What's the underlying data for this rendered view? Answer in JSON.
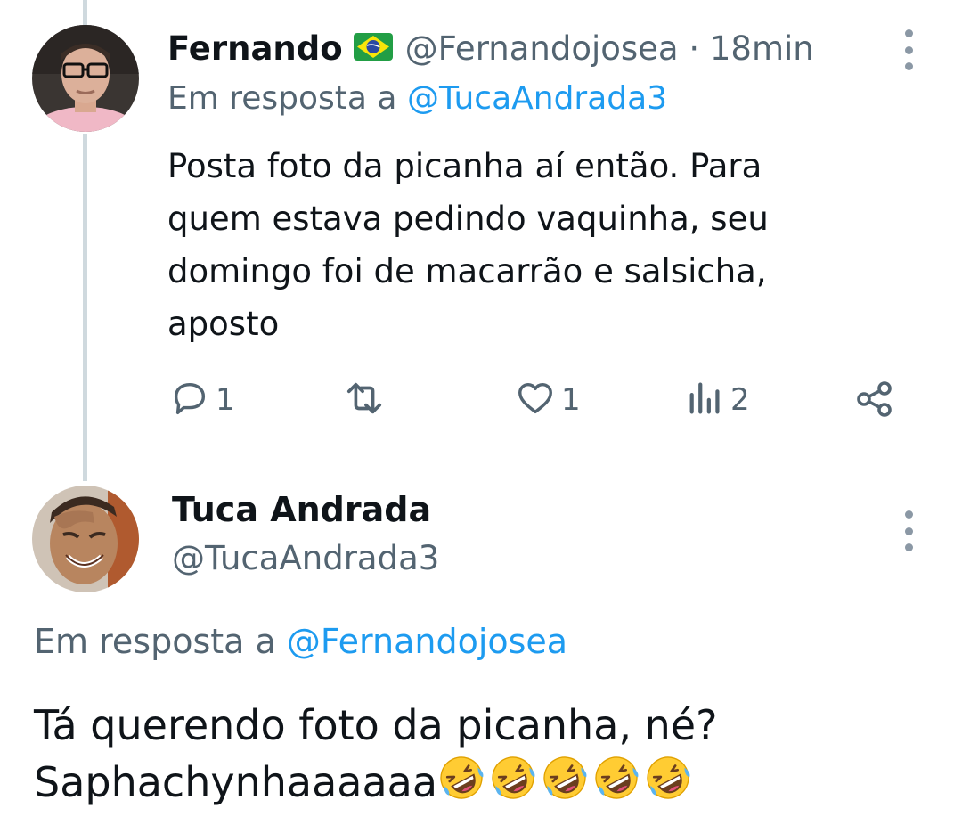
{
  "tweet1": {
    "display_name": "Fernando",
    "flag_icon": "brazil-flag",
    "handle_time": "@Fernandojosea · 18min",
    "reply_prefix": "Em resposta a",
    "reply_mention": "@TucaAndrada3",
    "text_lines": [
      "Posta foto da picanha aí então. Para",
      "quem estava pedindo vaquinha, seu",
      "domingo foi de macarrão e salsicha,",
      "aposto"
    ],
    "actions": {
      "reply_count": "1",
      "retweet_count": "",
      "like_count": "1",
      "views_count": "2"
    }
  },
  "tweet2": {
    "display_name": "Tuca Andrada",
    "handle": "@TucaAndrada3",
    "reply_prefix": "Em resposta a",
    "reply_mention": "@Fernandojosea",
    "text_line1": "Tá querendo foto da picanha, né?",
    "text_line2": "Saphachynhaaaaaa",
    "emoji_name": "rolling-on-the-floor-laughing",
    "emoji_count": 5
  },
  "colors": {
    "text": "#0f1419",
    "secondary": "#536471",
    "link": "#1d9bf0",
    "thread_line": "#cfd9de"
  }
}
